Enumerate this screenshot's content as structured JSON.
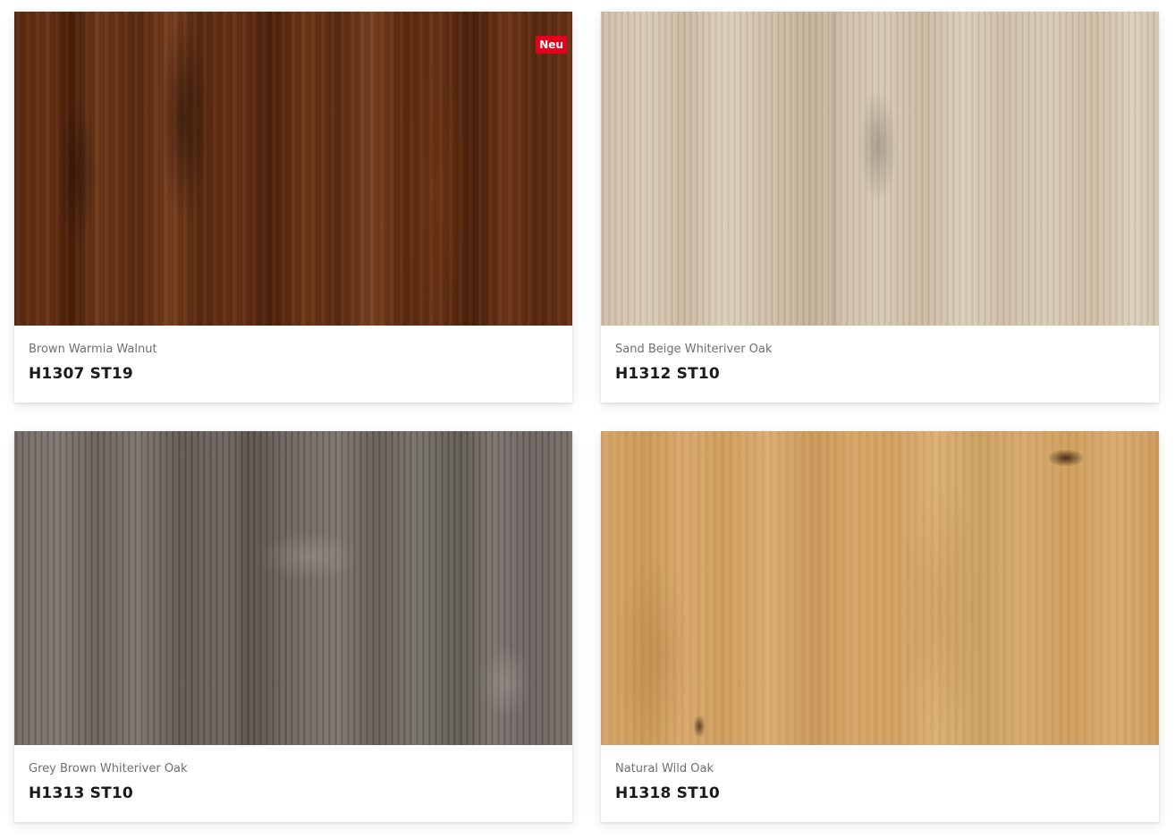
{
  "products": [
    {
      "name": "Brown Warmia Walnut",
      "code": "H1307 ST19",
      "badge": "Neu",
      "texture": "brown-walnut",
      "colors": [
        "#5a2a12",
        "#6e3a1c"
      ]
    },
    {
      "name": "Sand Beige Whiteriver Oak",
      "code": "H1312 ST10",
      "badge": null,
      "texture": "sand-beige-oak",
      "colors": [
        "#cbbba3",
        "#d8cbb7"
      ]
    },
    {
      "name": "Grey Brown Whiteriver Oak",
      "code": "H1313 ST10",
      "badge": null,
      "texture": "grey-brown-oak",
      "colors": [
        "#6f6863",
        "#58514c"
      ]
    },
    {
      "name": "Natural Wild Oak",
      "code": "H1318 ST10",
      "badge": null,
      "texture": "natural-oak",
      "colors": [
        "#d4a368",
        "#c99857"
      ]
    }
  ],
  "badge_color": "#e3001b"
}
